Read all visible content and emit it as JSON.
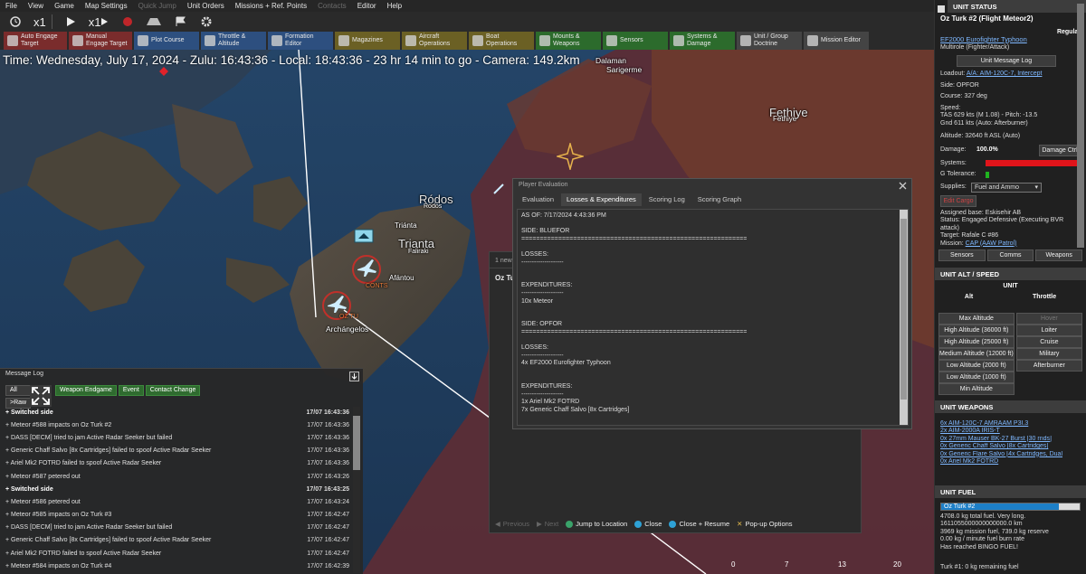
{
  "menu": [
    "File",
    "View",
    "Game",
    "Map Settings",
    "Quick Jump",
    "Unit Orders",
    "Missions + Ref. Points",
    "Contacts",
    "Editor",
    "Help"
  ],
  "toolbar1": {
    "speed1": "x1",
    "speed2": "x1"
  },
  "toolbar2": [
    {
      "label": "Auto Engage Target",
      "color": "#7a2c2c"
    },
    {
      "label": "Manual Engage Target",
      "color": "#7a2c2c"
    },
    {
      "label": "Plot Course",
      "color": "#2d4f7f"
    },
    {
      "label": "Throttle & Altitude",
      "color": "#2d4f7f"
    },
    {
      "label": "Formation Editor",
      "color": "#2d4f7f"
    },
    {
      "label": "Magazines",
      "color": "#6b6024"
    },
    {
      "label": "Aircraft Operations",
      "color": "#6b6024"
    },
    {
      "label": "Boat Operations",
      "color": "#6b6024"
    },
    {
      "label": "Mounts & Weapons",
      "color": "#2c6b2c"
    },
    {
      "label": "Sensors",
      "color": "#2c6b2c"
    },
    {
      "label": "Systems & Damage",
      "color": "#2c6b2c"
    },
    {
      "label": "Unit / Group Doctrine",
      "color": "#444444"
    },
    {
      "label": "Mission Editor",
      "color": "#444444"
    }
  ],
  "timebar": "Time: Wednesday, July 17, 2024 - Zulu: 16:43:36 - Local: 18:43:36 - 23 hr 14 min to go - Camera: 149.2km",
  "map_labels": {
    "dalaman": "Dalaman",
    "sarigerme": "Sarigerme",
    "fethiye": "Fethiye",
    "fethiye2": "Fethiye",
    "rodos": "Ródos",
    "rodos2": "Rodos",
    "trianta_small": "Triánta",
    "trianta": "Trianta",
    "faliraki": "Faliraki",
    "afantou": "Afántou",
    "archangelos": "Archángelos",
    "conts": "CONTS",
    "oz": "OZ TU"
  },
  "msglog": {
    "title": "Message Log",
    "filters": [
      "All",
      "Weapon Endgame",
      "Event",
      "Contact Change"
    ],
    "raw": ">Raw",
    "rows": [
      {
        "text": "Switched side",
        "time": "17/07 16:43:36",
        "bold": true
      },
      {
        "text": "Meteor #588 impacts on Oz Turk #2",
        "time": "17/07 16:43:36",
        "bold": false
      },
      {
        "text": "DASS [DECM] tried to jam Active Radar Seeker but failed",
        "time": "17/07 16:43:36",
        "bold": false
      },
      {
        "text": "Generic Chaff Salvo [8x Cartridges] failed to spoof Active Radar Seeker",
        "time": "17/07 16:43:36",
        "bold": false
      },
      {
        "text": "Ariel Mk2 FOTRD failed to spoof Active Radar Seeker",
        "time": "17/07 16:43:36",
        "bold": false
      },
      {
        "text": "Meteor #587 petered out",
        "time": "17/07 16:43:26",
        "bold": false
      },
      {
        "text": "Switched side",
        "time": "17/07 16:43:25",
        "bold": true
      },
      {
        "text": "Meteor #586 petered out",
        "time": "17/07 16:43:24",
        "bold": false
      },
      {
        "text": "Meteor #585 impacts on Oz Turk #3",
        "time": "17/07 16:42:47",
        "bold": false
      },
      {
        "text": "DASS [DECM] tried to jam Active Radar Seeker but failed",
        "time": "17/07 16:42:47",
        "bold": false
      },
      {
        "text": "Generic Chaff Salvo [8x Cartridges] failed to spoof Active Radar Seeker",
        "time": "17/07 16:42:47",
        "bold": false
      },
      {
        "text": "Ariel Mk2 FOTRD failed to spoof Active Radar Seeker",
        "time": "17/07 16:42:47",
        "bold": false
      },
      {
        "text": "Meteor #584 impacts on Oz Turk #4",
        "time": "17/07 16:42:39",
        "bold": false
      }
    ]
  },
  "pe": {
    "title": "Player Evaluation",
    "tabs": [
      "Evaluation",
      "Losses & Expenditures",
      "Scoring Log",
      "Scoring Graph"
    ],
    "body": "AS OF: 7/17/2024 4:43:36 PM\n\nSIDE: BLUEFOR\n=============================================================\n\nLOSSES:\n--------------------\n\n\nEXPENDITURES:\n--------------------\n10x Meteor\n\n\nSIDE: OPFOR\n=============================================================\n\nLOSSES:\n--------------------\n4x EF2000 Eurofighter Typhoon\n\n\nEXPENDITURES:\n--------------------\n1x Ariel Mk2 FOTRD\n7x Generic Chaff Salvo [8x Cartridges]"
  },
  "bgwin": {
    "new": "1 new",
    "oz": "Oz Tu",
    "prev": "Previous",
    "next": "Next",
    "jump": "Jump to Location",
    "close": "Close",
    "close_resume": "Close + Resume",
    "popup": "Pop-up Options"
  },
  "unit": {
    "panel_title": "UNIT STATUS",
    "name": "Oz Turk #2 (Flight Meteor2)",
    "proficiency": "Regular",
    "type": "EF2000 Eurofighter Typhoon",
    "role": "Multirole (Fighter/Attack)",
    "log_btn": "Unit Message Log",
    "loadout_label": "Loadout:",
    "loadout": "A/A: AIM-120C-7, Intercept",
    "side": "Side: OPFOR",
    "course": "Course: 327 deg",
    "speed_label": "Speed:",
    "speed1": "TAS 629 kts (M 1.08) - Pitch: -13.5",
    "speed2": "Gnd 611 kts (Auto: Afterburner)",
    "altitude": "Altitude: 32640 ft ASL (Auto)",
    "damage_label": "Damage:",
    "damage_val": "100.0%",
    "damage_ctrl": "Damage Ctrl",
    "systems_label": "Systems:",
    "gtol_label": "G Tolerance:",
    "supplies_label": "Supplies:",
    "supplies_val": "Fuel and Ammo",
    "edit_cargo": "Edit Cargo",
    "base": "Assigned base: Eskisehir AB",
    "status": "Status: Engaged Defensive (Executing BVR attack)",
    "target": "Target: Rafale C #86",
    "mission_label": "Mission:",
    "mission": "CAP (AAW Patrol)",
    "tabs": [
      "Sensors",
      "Comms",
      "Weapons"
    ]
  },
  "alt": {
    "panel_title": "UNIT ALT / SPEED",
    "unit": "UNIT",
    "alt": "Alt",
    "throttle": "Throttle",
    "alt_btns": [
      "Max Altitude",
      "High Altitude (36000 ft)",
      "High Altitude (25000 ft)",
      "Medium Altitude (12000 ft)",
      "Low Altitude (2000 ft)",
      "Low Altitude (1000 ft)",
      "Min Altitude"
    ],
    "thr_btns": [
      "Hover",
      "Loiter",
      "Cruise",
      "Military",
      "Afterburner"
    ]
  },
  "weapons": {
    "panel_title": "UNIT WEAPONS",
    "items": [
      "6x AIM-120C-7 AMRAAM P3I.3",
      "2x AIM-2000A IRIS-T",
      "0x 27mm Mauser BK-27 Burst [30 rnds]",
      "0x Generic Chaff Salvo [8x Cartridges]",
      "0x Generic Flare Salvo [4x Cartridges, Dual",
      "0x Ariel Mk2 FOTRD"
    ]
  },
  "fuel": {
    "panel_title": "UNIT FUEL",
    "bar_label": "Oz Turk #2",
    "bar_fraction": 0.85,
    "lines": [
      "4708.0 kg total fuel. Very long.",
      "1611055000000000000.0 km",
      "3969 kg mission fuel, 739.0 kg reserve",
      "0.00 kg / minute fuel burn rate",
      "Has reached BINGO FUEL!"
    ],
    "bottom": "Turk #1: 0 kg remaining fuel"
  },
  "scale": [
    "0",
    "7",
    "13",
    "20"
  ]
}
